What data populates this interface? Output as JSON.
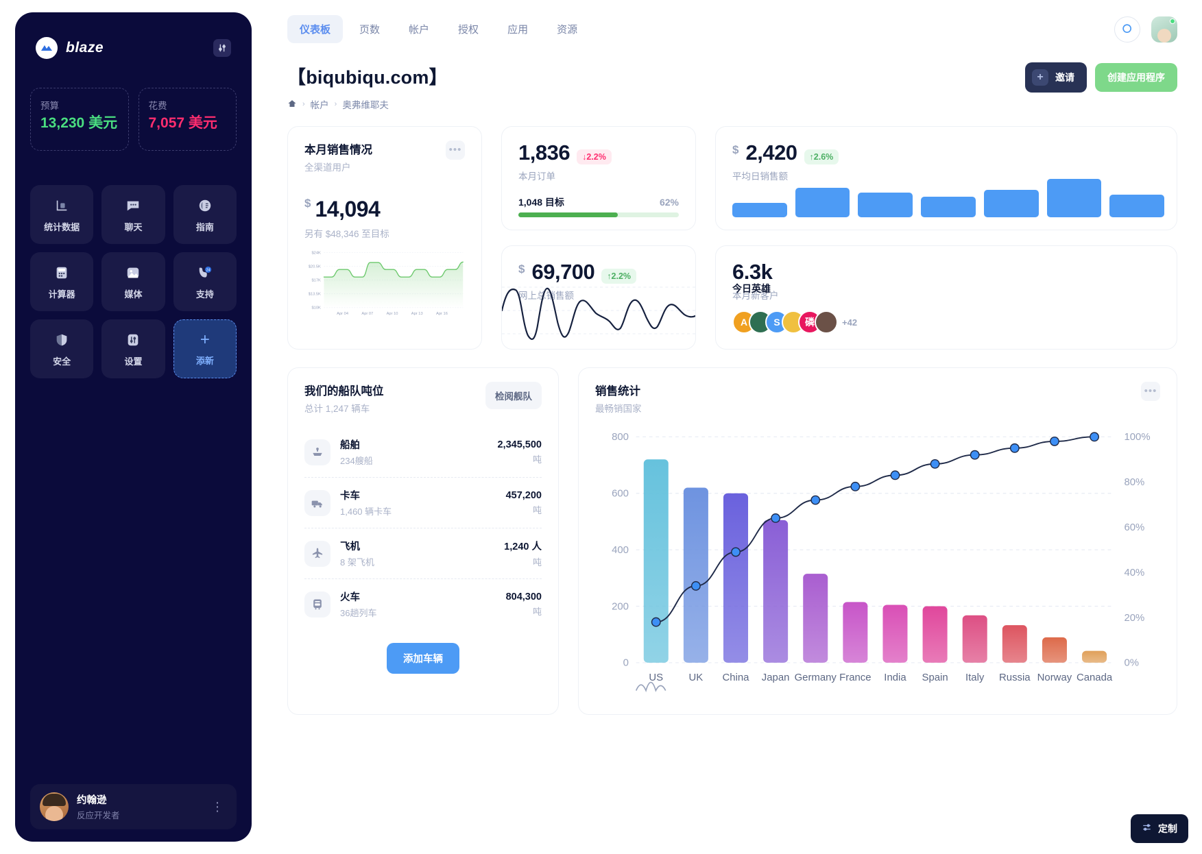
{
  "sidebar": {
    "brand": "blaze",
    "brand_icon": "blaze-logo-icon",
    "tools_icon": "sliders-icon",
    "budget": {
      "label": "预算",
      "value": "13,230 美元",
      "color": "#4ade80"
    },
    "spend": {
      "label": "花费",
      "value": "7,057 美元",
      "color": "#ff2d6f"
    },
    "tiles": [
      {
        "label": "统计数据",
        "icon": "bar-chart-icon"
      },
      {
        "label": "聊天",
        "icon": "chat-bubble-icon"
      },
      {
        "label": "指南",
        "icon": "guide-icon"
      },
      {
        "label": "计算器",
        "icon": "calculator-icon"
      },
      {
        "label": "媒体",
        "icon": "image-icon"
      },
      {
        "label": "支持",
        "icon": "support-24-icon"
      },
      {
        "label": "安全",
        "icon": "shield-icon"
      },
      {
        "label": "设置",
        "icon": "sliders-icon"
      },
      {
        "label": "添新",
        "icon": "plus-icon"
      }
    ],
    "user": {
      "name": "约翰逊",
      "role": "反应开发者",
      "more_icon": "kebab-menu-icon"
    }
  },
  "topbar": {
    "tabs": [
      {
        "label": "仪表板",
        "active": true
      },
      {
        "label": "页数",
        "active": false
      },
      {
        "label": "帐户",
        "active": false
      },
      {
        "label": "授权",
        "active": false
      },
      {
        "label": "应用",
        "active": false
      },
      {
        "label": "资源",
        "active": false
      }
    ],
    "search_icon": "search-circle-icon",
    "profile_icon": "user-avatar-icon"
  },
  "header": {
    "title": "【biqubiqu.com】",
    "breadcrumb": {
      "home_icon": "home-icon",
      "items": [
        "帐户",
        "奥弗维耶夫"
      ],
      "separator": "›"
    },
    "invite_label": "邀请",
    "invite_icon": "plus-icon",
    "create_label": "创建应用程序",
    "create_color": "#7ed88a"
  },
  "cards": {
    "orders": {
      "value": "1,836",
      "badge": "2.2%",
      "badge_dir": "down",
      "badge_arrow": "↓",
      "label": "本月订单",
      "goal_label": "1,048 目标",
      "goal_pct": "62%",
      "progress": 62
    },
    "avg_daily": {
      "currency": "$",
      "value": "2,420",
      "badge": "2.6%",
      "badge_dir": "up",
      "badge_arrow": "↑",
      "label": "平均日销售额",
      "bars": [
        26,
        52,
        44,
        36,
        48,
        68,
        40
      ]
    },
    "online_total": {
      "currency": "$",
      "value": "69,700",
      "badge": "2.2%",
      "badge_dir": "up",
      "badge_arrow": "↑",
      "label": "网上总销售额"
    },
    "new_customers": {
      "value": "6.3k",
      "label": "本月新客户",
      "heroes_title": "今日英雄",
      "heroes": [
        {
          "initial": "A",
          "color": "#f0a020"
        },
        {
          "initial": "",
          "color": "#2f6f52"
        },
        {
          "initial": "S",
          "color": "#4d9bf5"
        },
        {
          "initial": "",
          "color": "#f0c040"
        },
        {
          "initial": "磷",
          "color": "#e8185f"
        },
        {
          "initial": "",
          "color": "#6b5147"
        }
      ],
      "heroes_more": "+42"
    },
    "month_sales": {
      "title": "本月销售情况",
      "subtitle": "全渠道用户",
      "more_icon": "ellipsis-icon",
      "currency": "$",
      "value": "14,094",
      "sub": "另有 $48,346 至目标"
    },
    "fleet": {
      "title": "我们的船队吨位",
      "subtitle": "总计 1,247 辆车",
      "review_label": "检阅舰队",
      "rows": [
        {
          "icon": "ship-icon",
          "name": "船舶",
          "sub": "234艘船",
          "value": "2,345,500",
          "unit": "吨"
        },
        {
          "icon": "truck-icon",
          "name": "卡车",
          "sub": "1,460 辆卡车",
          "value": "457,200",
          "unit": "吨"
        },
        {
          "icon": "plane-icon",
          "name": "飞机",
          "sub": "8 架飞机",
          "value": "1,240 人",
          "unit": "吨"
        },
        {
          "icon": "train-icon",
          "name": "火车",
          "sub": "36趟列车",
          "value": "804,300",
          "unit": "吨"
        }
      ],
      "add_label": "添加车辆"
    }
  },
  "chart_data": [
    {
      "type": "area",
      "title": "本月销售情况",
      "subtitle": "全渠道用户",
      "xlabel": "",
      "ylabel": "",
      "ylim": [
        10000,
        24000
      ],
      "yticks": [
        "$10K",
        "$13.5K",
        "$17K",
        "$20.5K",
        "$24K"
      ],
      "ytick_values": [
        10000,
        13500,
        17000,
        20500,
        24000
      ],
      "xticks": [
        "Apr 04",
        "Apr 07",
        "Apr 10",
        "Apr 13",
        "Apr 16"
      ],
      "grid": true,
      "legend": "none",
      "line_color": "#6dc96d",
      "values": [
        17800,
        17800,
        19700,
        19700,
        17800,
        17800,
        21500,
        21500,
        19700,
        19700,
        17800,
        17800,
        19700,
        19700,
        17800,
        17800,
        19700,
        19700,
        21600
      ]
    },
    {
      "type": "bar",
      "title": "销售统计",
      "subtitle": "最畅销国家",
      "xlabel": "",
      "ylabel": "",
      "ylim": [
        0,
        800
      ],
      "yticks": [
        "0",
        "200",
        "400",
        "600",
        "800"
      ],
      "categories": [
        "US",
        "UK",
        "China",
        "Japan",
        "Germany",
        "France",
        "India",
        "Spain",
        "Italy",
        "Russia",
        "Norway",
        "Canada"
      ],
      "values": [
        720,
        620,
        600,
        505,
        315,
        215,
        205,
        200,
        168,
        133,
        90,
        42
      ],
      "bar_colors": [
        "#66c2dd",
        "#6e93e0",
        "#6a61dd",
        "#8a5fd6",
        "#a95ed0",
        "#c755c8",
        "#d94fb6",
        "#e0479c",
        "#dd4f84",
        "#dd5560",
        "#dd6a4a",
        "#e0a05a"
      ],
      "grid": true,
      "legend": "none",
      "secondary": {
        "type": "line",
        "name": "cumulative",
        "yticks": [
          "0%",
          "20%",
          "40%",
          "60%",
          "80%",
          "100%"
        ],
        "ylim": [
          0,
          100
        ],
        "values": [
          18,
          34,
          49,
          64,
          72,
          78,
          83,
          88,
          92,
          95,
          98,
          100
        ],
        "line_color": "#1f2a48",
        "marker_color": "#3d8ff5"
      }
    }
  ],
  "footer": {
    "customize_label": "定制",
    "customize_icon": "sliders-icon"
  }
}
